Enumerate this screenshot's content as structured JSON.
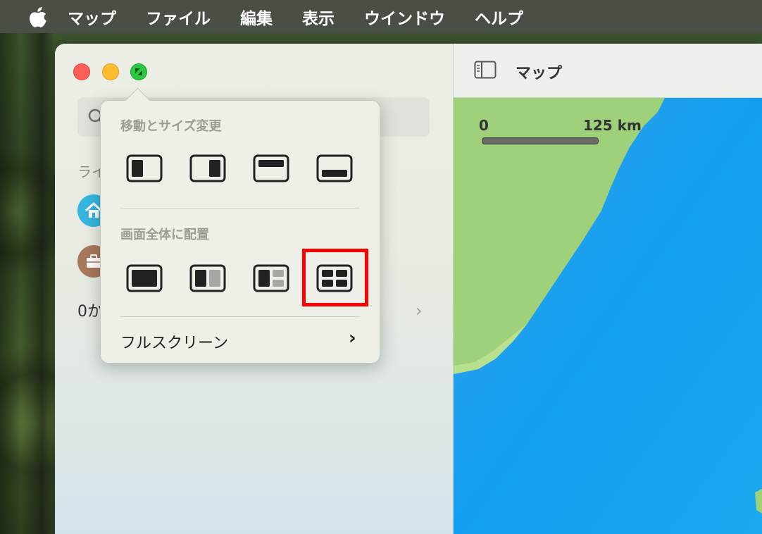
{
  "menubar": {
    "apple_icon": "apple-logo-icon",
    "items": [
      "マップ",
      "ファイル",
      "編集",
      "表示",
      "ウインドウ",
      "ヘルプ"
    ]
  },
  "sidebar": {
    "section_label": "ライ",
    "count_text": "0か",
    "favorites": [
      {
        "icon": "home-icon",
        "color": "#36b7e0"
      },
      {
        "icon": "briefcase-icon",
        "color": "#a9785c"
      }
    ]
  },
  "toolbar": {
    "title": "マップ",
    "sidebar_toggle_icon": "sidebar-toggle-icon"
  },
  "map": {
    "scale_start": "0",
    "scale_distance": "125 km"
  },
  "popover": {
    "move_resize_heading": "移動とサイズ変更",
    "fill_arrange_heading": "画面全体に配置",
    "fullscreen_label": "フルスクリーン",
    "move_resize_options": [
      "left-half-icon",
      "right-half-icon",
      "top-half-icon",
      "bottom-half-icon"
    ],
    "fill_arrange_options": [
      "full-window-icon",
      "split-two-icon",
      "split-three-icon",
      "grid-four-icon"
    ],
    "highlighted_option": "grid-four-icon"
  },
  "colors": {
    "close": "#fe5f57",
    "minimize": "#febc2e",
    "zoom": "#28c840",
    "highlight": "#ff0000",
    "land": "#9fd17a",
    "water": "#19a3f0"
  }
}
